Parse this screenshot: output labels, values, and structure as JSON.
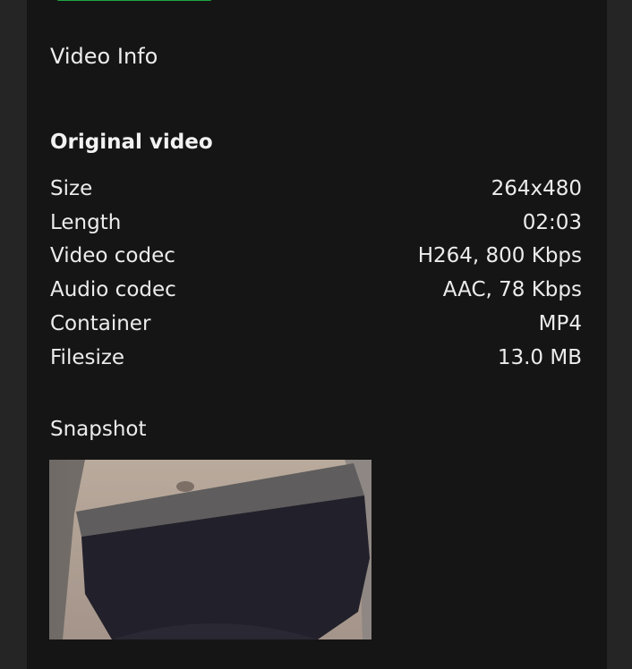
{
  "video_info": {
    "title": "Video Info",
    "original_heading": "Original video",
    "rows": [
      {
        "label": "Size",
        "value": "264x480"
      },
      {
        "label": "Length",
        "value": "02:03"
      },
      {
        "label": "Video codec",
        "value": "H264, 800 Kbps"
      },
      {
        "label": "Audio codec",
        "value": "AAC, 78 Kbps"
      },
      {
        "label": "Container",
        "value": "MP4"
      },
      {
        "label": "Filesize",
        "value": "13.0 MB"
      }
    ]
  },
  "snapshot": {
    "title": "Snapshot"
  },
  "colors": {
    "background": "#252525",
    "panel": "#151515",
    "accent": "#1fa543",
    "text": "#ececec"
  }
}
